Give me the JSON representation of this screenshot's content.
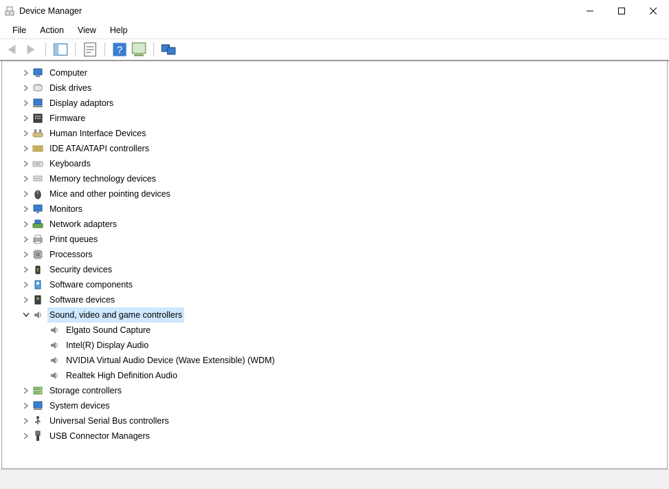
{
  "window": {
    "title": "Device Manager"
  },
  "menubar": {
    "items": [
      "File",
      "Action",
      "View",
      "Help"
    ]
  },
  "toolbar": {
    "back": "back-icon",
    "forward": "forward-icon",
    "show_hide_tree": "tree-pane-icon",
    "properties": "properties-icon",
    "help": "help-icon",
    "scan": "scan-hw-icon",
    "remote": "remote-icon"
  },
  "tree": {
    "nodes": [
      {
        "label": "Computer",
        "icon": "computer-icon",
        "state": "collapsed",
        "level": 1
      },
      {
        "label": "Disk drives",
        "icon": "disk-icon",
        "state": "collapsed",
        "level": 1
      },
      {
        "label": "Display adaptors",
        "icon": "display-icon",
        "state": "collapsed",
        "level": 1
      },
      {
        "label": "Firmware",
        "icon": "firmware-icon",
        "state": "collapsed",
        "level": 1
      },
      {
        "label": "Human Interface Devices",
        "icon": "hid-icon",
        "state": "collapsed",
        "level": 1
      },
      {
        "label": "IDE ATA/ATAPI controllers",
        "icon": "ide-icon",
        "state": "collapsed",
        "level": 1
      },
      {
        "label": "Keyboards",
        "icon": "keyboard-icon",
        "state": "collapsed",
        "level": 1
      },
      {
        "label": "Memory technology devices",
        "icon": "memory-icon",
        "state": "collapsed",
        "level": 1
      },
      {
        "label": "Mice and other pointing devices",
        "icon": "mouse-icon",
        "state": "collapsed",
        "level": 1
      },
      {
        "label": "Monitors",
        "icon": "monitor-icon",
        "state": "collapsed",
        "level": 1
      },
      {
        "label": "Network adapters",
        "icon": "network-icon",
        "state": "collapsed",
        "level": 1
      },
      {
        "label": "Print queues",
        "icon": "printer-icon",
        "state": "collapsed",
        "level": 1
      },
      {
        "label": "Processors",
        "icon": "cpu-icon",
        "state": "collapsed",
        "level": 1
      },
      {
        "label": "Security devices",
        "icon": "security-icon",
        "state": "collapsed",
        "level": 1
      },
      {
        "label": "Software components",
        "icon": "swcomp-icon",
        "state": "collapsed",
        "level": 1
      },
      {
        "label": "Software devices",
        "icon": "swdev-icon",
        "state": "collapsed",
        "level": 1
      },
      {
        "label": "Sound, video and game controllers",
        "icon": "sound-icon",
        "state": "expanded",
        "level": 1,
        "selected": true
      },
      {
        "label": "Elgato Sound Capture",
        "icon": "sound-icon",
        "state": "leaf",
        "level": 2
      },
      {
        "label": "Intel(R) Display Audio",
        "icon": "sound-icon",
        "state": "leaf",
        "level": 2
      },
      {
        "label": "NVIDIA Virtual Audio Device (Wave Extensible) (WDM)",
        "icon": "sound-icon",
        "state": "leaf",
        "level": 2
      },
      {
        "label": "Realtek High Definition Audio",
        "icon": "sound-icon",
        "state": "leaf",
        "level": 2
      },
      {
        "label": "Storage controllers",
        "icon": "storage-icon",
        "state": "collapsed",
        "level": 1
      },
      {
        "label": "System devices",
        "icon": "system-icon",
        "state": "collapsed",
        "level": 1
      },
      {
        "label": "Universal Serial Bus controllers",
        "icon": "usb-icon",
        "state": "collapsed",
        "level": 1
      },
      {
        "label": "USB Connector Managers",
        "icon": "usbconn-icon",
        "state": "collapsed",
        "level": 1
      }
    ]
  },
  "colors": {
    "selection": "#cde8ff",
    "chevron": "#707070"
  }
}
